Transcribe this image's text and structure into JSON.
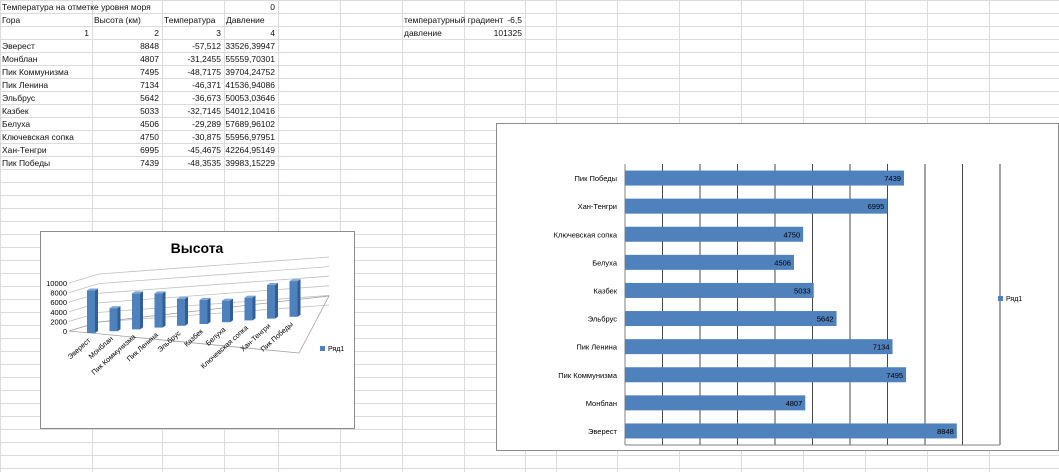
{
  "sheet": {
    "a1": "Температура на отметке уровня моря",
    "c1": "0",
    "headers": [
      "Гора",
      "Высота (км)",
      "Температура",
      "Давление"
    ],
    "indices": [
      "1",
      "2",
      "3",
      "4"
    ],
    "rows": [
      {
        "name": "Эверест",
        "height": "8848",
        "temp": "-57,512",
        "pressure": "33526,39947"
      },
      {
        "name": "Монблан",
        "height": "4807",
        "temp": "-31,2455",
        "pressure": "55559,70301"
      },
      {
        "name": "Пик Коммунизма",
        "height": "7495",
        "temp": "-48,7175",
        "pressure": "39704,24752"
      },
      {
        "name": "Пик Ленина",
        "height": "7134",
        "temp": "-46,371",
        "pressure": "41536,94086"
      },
      {
        "name": "Эльбрус",
        "height": "5642",
        "temp": "-36,673",
        "pressure": "50053,03646"
      },
      {
        "name": "Казбек",
        "height": "5033",
        "temp": "-32,7145",
        "pressure": "54012,10416"
      },
      {
        "name": "Белуха",
        "height": "4506",
        "temp": "-29,289",
        "pressure": "57689,96102"
      },
      {
        "name": "Ключевская сопка",
        "height": "4750",
        "temp": "-30,875",
        "pressure": "55956,97951"
      },
      {
        "name": "Хан-Тенгри",
        "height": "6995",
        "temp": "-45,4675",
        "pressure": "42264,95149"
      },
      {
        "name": "Пик Победы",
        "height": "7439",
        "temp": "-48,3535",
        "pressure": "39983,15229"
      }
    ],
    "gradient_label": "температурный градиент",
    "gradient_value": "-6,5",
    "pressure_label": "давление",
    "pressure_value": "101325"
  },
  "chart_data": [
    {
      "type": "bar",
      "title": "Высота",
      "categories": [
        "Эверест",
        "Монблан",
        "Пик Коммунизма",
        "Пик Ленина",
        "Эльбрус",
        "Казбек",
        "Белуха",
        "Ключевская сопка",
        "Хан-Тенгри",
        "Пик Победы"
      ],
      "series": [
        {
          "name": "Ряд1",
          "values": [
            8848,
            4807,
            7495,
            7134,
            5642,
            5033,
            4506,
            4750,
            6995,
            7439
          ]
        }
      ],
      "ylim": [
        0,
        10000
      ],
      "yticks": [
        "10000",
        "8000",
        "6000",
        "4000",
        "2000",
        "0"
      ],
      "grid": true,
      "legend": "right",
      "color": "#4f81bd"
    },
    {
      "type": "bar",
      "orientation": "horizontal",
      "categories": [
        "Эверест",
        "Монблан",
        "Пик Коммунизма",
        "Пик Ленина",
        "Эльбрус",
        "Казбек",
        "Белуха",
        "Ключевская сопка",
        "Хан-Тенгри",
        "Пик Победы"
      ],
      "series": [
        {
          "name": "Ряд1",
          "values": [
            8848,
            4807,
            7495,
            7134,
            5642,
            5033,
            4506,
            4750,
            6995,
            7439
          ]
        }
      ],
      "xlim": [
        0,
        10000
      ],
      "grid": true,
      "data_labels": true,
      "legend": "right",
      "color": "#4f81bd"
    }
  ]
}
